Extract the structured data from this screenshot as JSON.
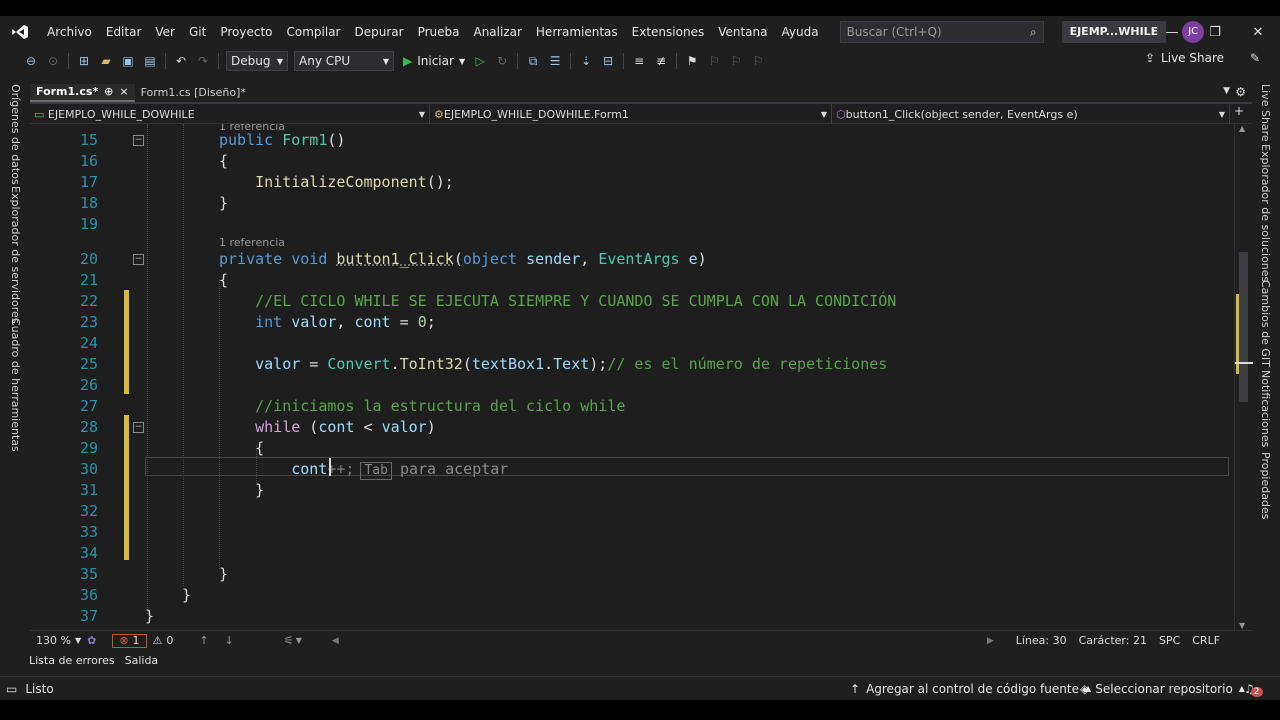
{
  "menu": {
    "items": [
      "Archivo",
      "Editar",
      "Ver",
      "Git",
      "Proyecto",
      "Compilar",
      "Depurar",
      "Prueba",
      "Analizar",
      "Herramientas",
      "Extensiones",
      "Ventana",
      "Ayuda"
    ],
    "search_placeholder": "Buscar (Ctrl+Q)",
    "solution_name": "EJEMP...WHILE",
    "avatar_initials": "JC"
  },
  "toolbar": {
    "config": "Debug",
    "platform": "Any CPU",
    "start_label": "Iniciar",
    "live_share": "Live Share"
  },
  "left_rail": {
    "tabs": [
      "Orígenes de datos",
      "Explorador de servidores",
      "Cuadro de herramientas"
    ]
  },
  "right_rail": {
    "tabs": [
      "Live Share",
      "Explorador de soluciones",
      "Cambios de GIT",
      "Notificaciones",
      "Propiedades"
    ]
  },
  "doc_tabs": [
    {
      "label": "Form1.cs*",
      "pin": "⊕",
      "close": "×"
    },
    {
      "label": "Form1.cs [Diseño]*"
    }
  ],
  "nav_bar": {
    "project": "EJEMPLO_WHILE_DOWHILE",
    "class": "EJEMPLO_WHILE_DOWHILE.Form1",
    "member": "button1_Click(object sender, EventArgs e)"
  },
  "editor": {
    "codelens_top": "1 referencia",
    "codelens_method": "1 referencia",
    "lines": [
      "15",
      "16",
      "17",
      "18",
      "19",
      "20",
      "21",
      "22",
      "23",
      "24",
      "25",
      "26",
      "27",
      "28",
      "29",
      "30",
      "31",
      "32",
      "33",
      "34",
      "35",
      "36",
      "37"
    ],
    "code": {
      "l15_kw": "public",
      "l15_name": "Form1",
      "l15_rest": "()",
      "l16": "{",
      "l17_method": "InitializeComponent",
      "l17_rest": "();",
      "l18": "}",
      "l20_kw1": "private",
      "l20_kw2": "void",
      "l20_method": "button1_Click",
      "l20_p1": "(",
      "l20_kw3": "object",
      "l20_p2": "sender",
      "l20_comma": ", ",
      "l20_type": "EventArgs",
      "l20_p3": "e",
      "l20_end": ")",
      "l21": "{",
      "l22_comment": "//EL CICLO WHILE SE EJECUTA SIEMPRE Y CUANDO SE CUMPLA CON LA CONDICIÓN",
      "l23_kw": "int",
      "l23_v1": "valor",
      "l23_comma": ", ",
      "l23_v2": "cont",
      "l23_eq": " = ",
      "l23_num": "0",
      "l23_end": ";",
      "l25_v": "valor",
      "l25_eq": " = ",
      "l25_type": "Convert",
      "l25_dot": ".",
      "l25_method": "ToInt32",
      "l25_open": "(",
      "l25_arg": "textBox1",
      "l25_dot2": ".",
      "l25_prop": "Text",
      "l25_close": ");",
      "l25_comment": "// es el número de repeticiones",
      "l27_comment": "//iniciamos la estructura del ciclo while",
      "l28_kw": "while",
      "l28_open": " (",
      "l28_v1": "cont",
      "l28_lt": " < ",
      "l28_v2": "valor",
      "l28_close": ")",
      "l29": "{",
      "l30_typed": "cont",
      "l30_ghost": "++;",
      "l30_tab": "Tab",
      "l30_hint": "para aceptar",
      "l31": "}",
      "l35": "}",
      "l36": "}",
      "l37": "}"
    }
  },
  "editor_status": {
    "zoom": "130 %",
    "errors": "1",
    "warnings": "0",
    "line": "Línea: 30",
    "char": "Carácter: 21",
    "spc": "SPC",
    "crlf": "CRLF"
  },
  "panel_tabs": [
    "Lista de errores",
    "Salida"
  ],
  "statusbar": {
    "ready": "Listo",
    "source_control": "Agregar al control de código fuente",
    "repo": "Seleccionar repositorio",
    "notif_count": "2"
  },
  "colors": {
    "keyword": "#569cd6",
    "type": "#4ec9b0",
    "method": "#dcdcaa",
    "variable": "#9cdcfe",
    "comment": "#57a64a",
    "change_bar": "#d7ba3d"
  }
}
